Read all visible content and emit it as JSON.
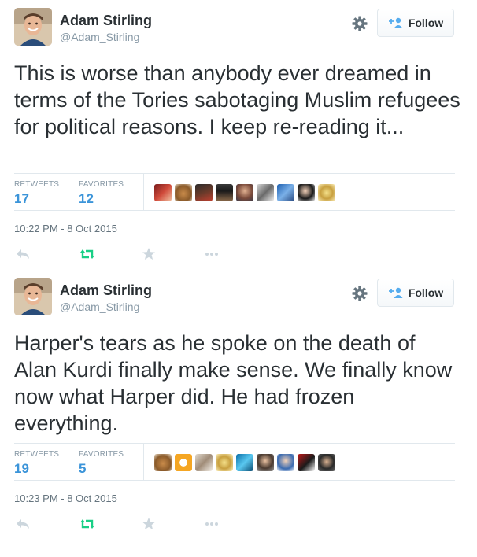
{
  "colors": {
    "name": "#292f33",
    "muted": "#8899a6",
    "stat_value": "#3b94d9",
    "retweeted": "#19cf86",
    "action_icon": "#ccd6dd"
  },
  "tweets": [
    {
      "author": {
        "display_name": "Adam Stirling",
        "screen_name": "@Adam_Stirling"
      },
      "follow_label": "Follow",
      "text": "This is worse than anybody ever dreamed in terms of the Tories sabotaging Muslim refugees for political reasons. I keep re-reading it...",
      "stats": {
        "retweets_label": "RETWEETS",
        "retweets": "17",
        "favorites_label": "FAVORITES",
        "favorites": "12"
      },
      "favoriter_count": 9,
      "timestamp": "10:22 PM - 8 Oct 2015",
      "icons": [
        "gear-icon",
        "follow-person-icon",
        "reply-icon",
        "retweet-icon",
        "favorite-star-icon",
        "more-dots-icon"
      ]
    },
    {
      "author": {
        "display_name": "Adam Stirling",
        "screen_name": "@Adam_Stirling"
      },
      "follow_label": "Follow",
      "text": "Harper's tears as he spoke on the death of Alan Kurdi finally make sense. We finally know now what Harper did. He had frozen everything.",
      "stats": {
        "retweets_label": "RETWEETS",
        "retweets": "19",
        "favorites_label": "FAVORITES",
        "favorites": "5"
      },
      "favoriter_count": 9,
      "timestamp": "10:23 PM - 8 Oct 2015",
      "icons": [
        "gear-icon",
        "follow-person-icon",
        "reply-icon",
        "retweet-icon",
        "favorite-star-icon",
        "more-dots-icon"
      ]
    }
  ]
}
